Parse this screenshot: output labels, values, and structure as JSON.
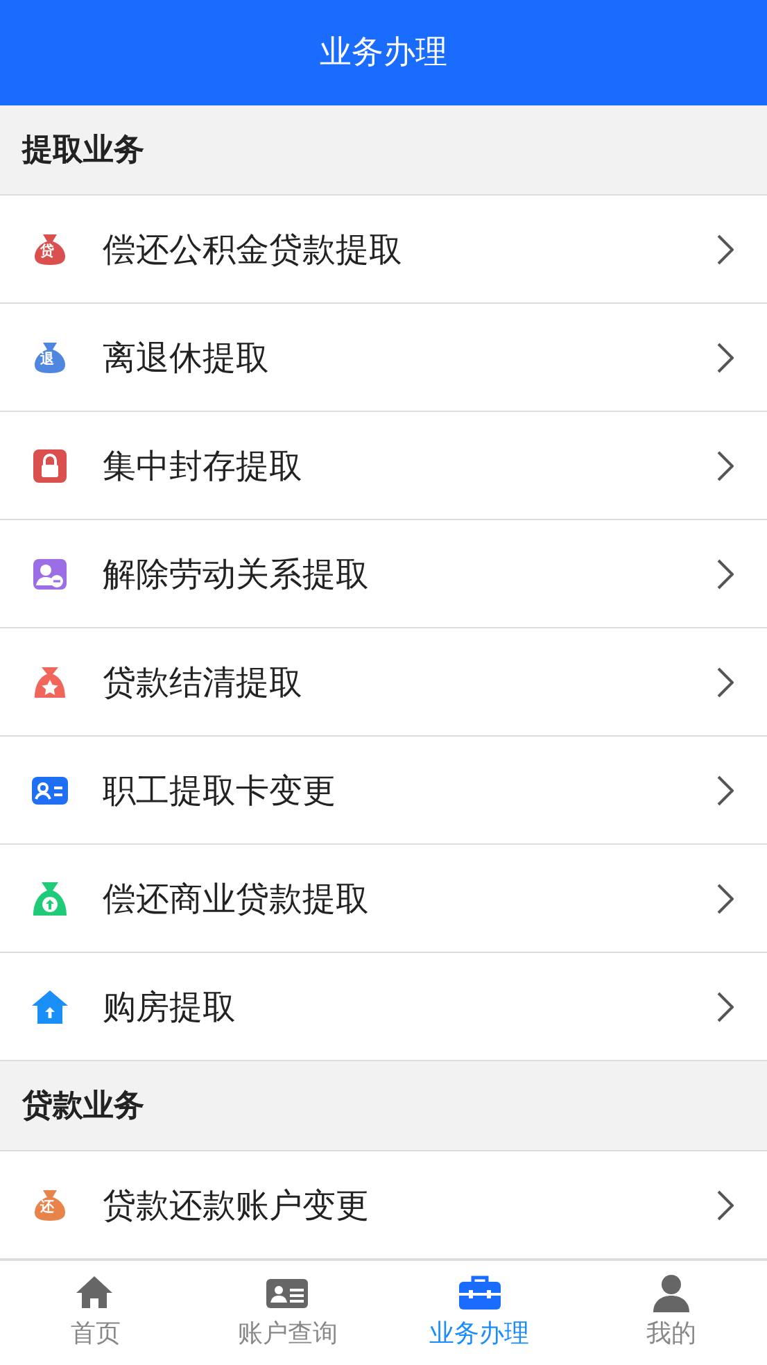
{
  "header": {
    "title": "业务办理"
  },
  "sections": [
    {
      "title": "提取业务",
      "items": [
        {
          "label": "偿还公积金贷款提取",
          "glyph": "贷"
        },
        {
          "label": "离退休提取",
          "glyph": "退"
        },
        {
          "label": "集中封存提取"
        },
        {
          "label": "解除劳动关系提取"
        },
        {
          "label": "贷款结清提取"
        },
        {
          "label": "职工提取卡变更"
        },
        {
          "label": "偿还商业贷款提取"
        },
        {
          "label": "购房提取"
        }
      ]
    },
    {
      "title": "贷款业务",
      "items": [
        {
          "label": "贷款还款账户变更",
          "glyph": "还"
        }
      ]
    }
  ],
  "tabs": [
    {
      "label": "首页",
      "selected": false
    },
    {
      "label": "账户查询",
      "selected": false
    },
    {
      "label": "业务办理",
      "selected": true
    },
    {
      "label": "我的",
      "selected": false
    }
  ]
}
